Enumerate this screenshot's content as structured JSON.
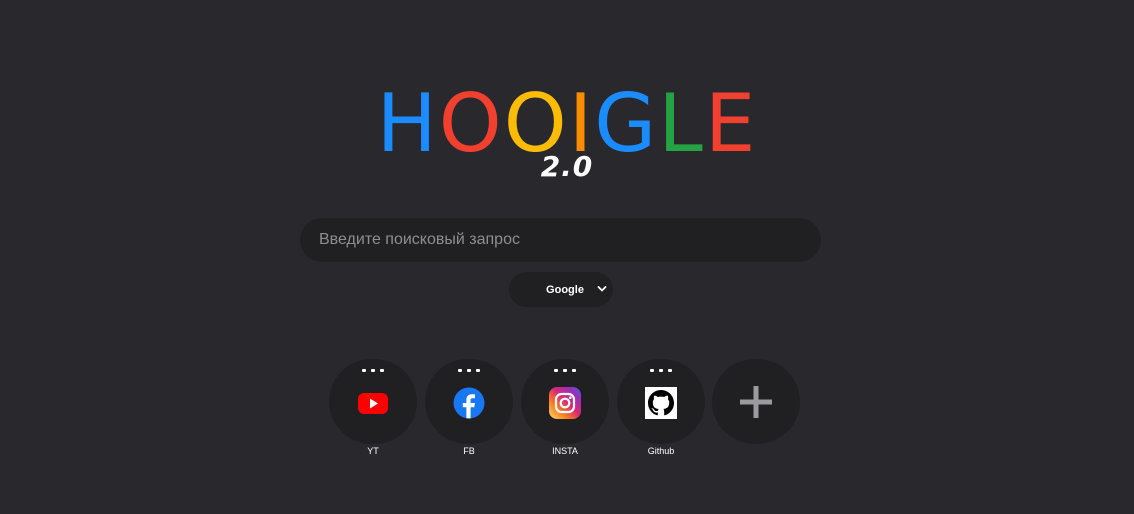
{
  "logo": {
    "letters": [
      {
        "char": "H",
        "color": "#1a8cff"
      },
      {
        "char": "O",
        "color": "#f2402f"
      },
      {
        "char": "O",
        "color": "#fcbc05"
      },
      {
        "char": "I",
        "color": "#fb8c00"
      },
      {
        "char": "G",
        "color": "#1a8cff"
      },
      {
        "char": "L",
        "color": "#25a244"
      },
      {
        "char": "E",
        "color": "#f2402f"
      }
    ],
    "version": "2.0"
  },
  "search": {
    "placeholder": "Введите поисковый запрос",
    "value": ""
  },
  "engine_select": {
    "selected": "Google",
    "icon": "chevron-down-icon"
  },
  "shortcuts": [
    {
      "label": "YT",
      "icon": "youtube-icon",
      "color": "#ff0000"
    },
    {
      "label": "FB",
      "icon": "facebook-icon",
      "color": "#1877f2"
    },
    {
      "label": "INSTA",
      "icon": "instagram-icon",
      "color": "#d62976"
    },
    {
      "label": "Github",
      "icon": "github-icon",
      "color": "#000000"
    }
  ],
  "add_shortcut": {
    "icon": "plus-icon"
  },
  "colors": {
    "background": "#29282d",
    "surface": "#202023"
  }
}
